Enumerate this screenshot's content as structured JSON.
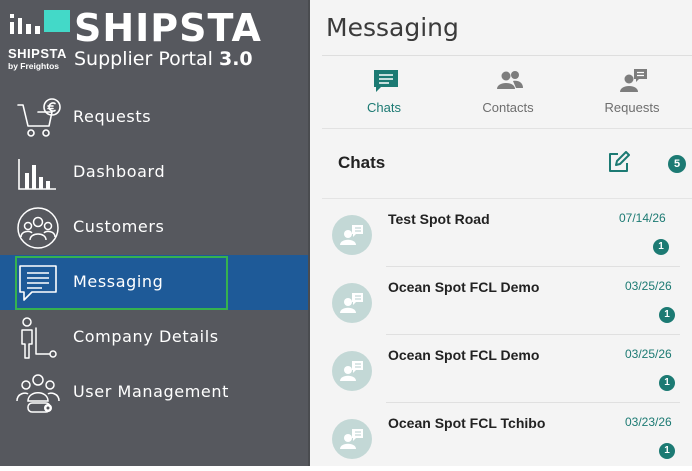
{
  "brand": {
    "small_name": "SHIPSTA",
    "by_line": "by Freightos",
    "title": "SHIPSTA",
    "subtitle_text": "Supplier Portal",
    "subtitle_version": "3.0",
    "accent_color": "#43d9c8"
  },
  "sidebar": {
    "items": [
      {
        "label": "Requests",
        "icon": "shopping-cart-euro-icon"
      },
      {
        "label": "Dashboard",
        "icon": "bar-chart-icon"
      },
      {
        "label": "Customers",
        "icon": "customers-group-icon"
      },
      {
        "label": "Messaging",
        "icon": "message-icon",
        "active": true
      },
      {
        "label": "Company Details",
        "icon": "person-hand-truck-icon"
      },
      {
        "label": "User Management",
        "icon": "users-gear-icon"
      }
    ],
    "active_color": "#1e5a98",
    "focus_color": "#35b24f"
  },
  "main": {
    "title": "Messaging",
    "tabs": [
      {
        "label": "Chats",
        "icon": "chat-bubble-icon",
        "active": true
      },
      {
        "label": "Contacts",
        "icon": "contacts-icon"
      },
      {
        "label": "Requests",
        "icon": "person-message-icon"
      }
    ],
    "chats_heading": "Chats",
    "chat_count": "5",
    "accent_color": "#1c7a73"
  },
  "chats": [
    {
      "name": "Test Spot Road",
      "date": "07/14/26",
      "unread": "1"
    },
    {
      "name": "Ocean Spot FCL Demo",
      "date": "03/25/26",
      "unread": "1"
    },
    {
      "name": "Ocean Spot FCL Demo",
      "date": "03/25/26",
      "unread": "1"
    },
    {
      "name": "Ocean Spot FCL Tchibo",
      "date": "03/23/26",
      "unread": "1"
    }
  ]
}
